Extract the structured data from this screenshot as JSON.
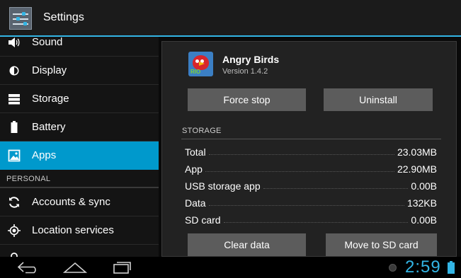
{
  "actionbar": {
    "title": "Settings",
    "icon": "settings-sliders-icon"
  },
  "sidebar": {
    "items": [
      {
        "label": "Sound",
        "icon": "sound-icon"
      },
      {
        "label": "Display",
        "icon": "display-brightness-icon"
      },
      {
        "label": "Storage",
        "icon": "storage-icon"
      },
      {
        "label": "Battery",
        "icon": "battery-icon"
      },
      {
        "label": "Apps",
        "icon": "apps-icon",
        "selected": true
      },
      {
        "label": "Accounts & sync",
        "icon": "sync-icon"
      },
      {
        "label": "Location services",
        "icon": "location-icon"
      }
    ],
    "section_personal": "PERSONAL"
  },
  "app_info": {
    "name": "Angry Birds",
    "version": "Version 1.4.2",
    "force_stop_label": "Force stop",
    "uninstall_label": "Uninstall",
    "storage_header": "STORAGE",
    "storage_rows": [
      {
        "label": "Total",
        "value": "23.03MB"
      },
      {
        "label": "App",
        "value": "22.90MB"
      },
      {
        "label": "USB storage app",
        "value": "0.00B"
      },
      {
        "label": "Data",
        "value": "132KB"
      },
      {
        "label": "SD card",
        "value": "0.00B"
      }
    ],
    "clear_data_label": "Clear data",
    "move_sd_label": "Move to SD card"
  },
  "navbar": {
    "time": "2:59"
  },
  "colors": {
    "accent": "#33b5e5",
    "selected": "#0099cc",
    "button": "#5c5c5c"
  }
}
